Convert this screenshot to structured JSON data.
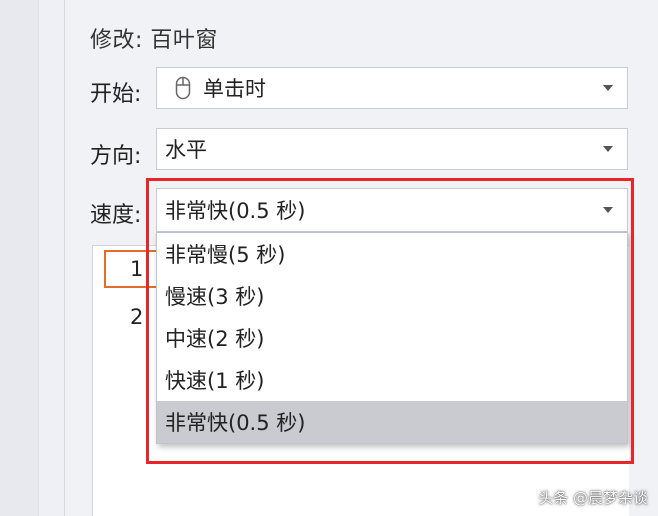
{
  "panel": {
    "title": "修改: 百叶窗",
    "start": {
      "label": "开始:",
      "value": "单击时",
      "icon": "mouse-icon"
    },
    "direction": {
      "label": "方向:",
      "value": "水平"
    },
    "speed": {
      "label": "速度:",
      "value": "非常快(0.5 秒)",
      "options": [
        "非常慢(5 秒)",
        "慢速(3 秒)",
        "中速(2 秒)",
        "快速(1 秒)",
        "非常快(0.5 秒)"
      ],
      "selected_index": 4
    }
  },
  "animation_list": {
    "items": [
      "1",
      "2"
    ]
  },
  "watermark": "头条 @晨梦杂谈",
  "colors": {
    "highlight_frame": "#e8262a",
    "list_marker": "#e36c2b",
    "selected_option": "#c9cbd0"
  }
}
